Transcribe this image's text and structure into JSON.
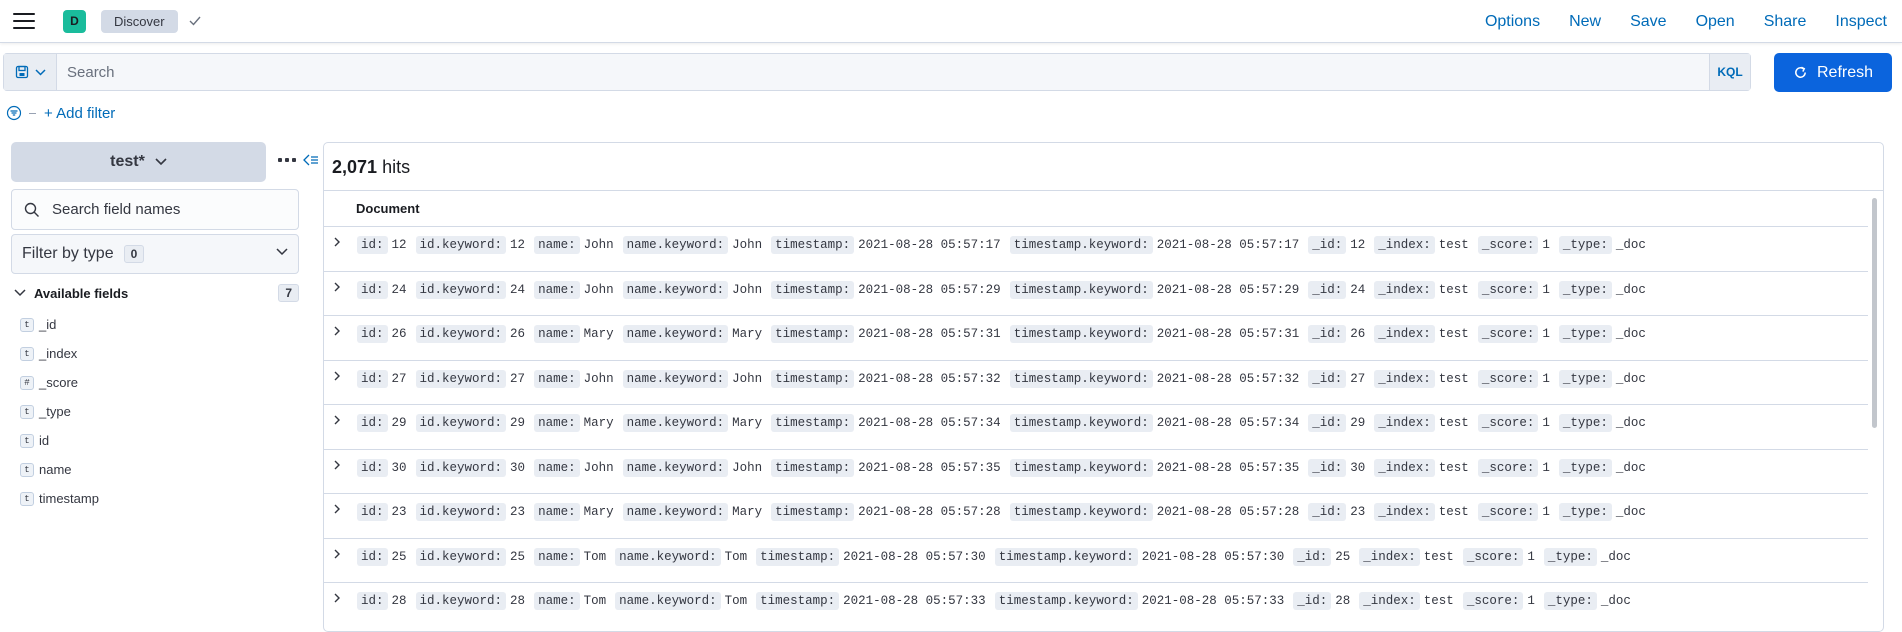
{
  "header": {
    "space_initial": "D",
    "breadcrumb": "Discover",
    "links": [
      "Options",
      "New",
      "Save",
      "Open",
      "Share",
      "Inspect"
    ]
  },
  "query": {
    "placeholder": "Search",
    "language": "KQL",
    "refresh_label": "Refresh"
  },
  "filters": {
    "add_label": "+ Add filter"
  },
  "sidebar": {
    "index_pattern": "test*",
    "search_placeholder": "Search field names",
    "filter_by_type_label": "Filter by type",
    "filter_by_type_count": "0",
    "available_label": "Available fields",
    "available_count": "7",
    "fields": [
      {
        "type": "t",
        "name": "_id"
      },
      {
        "type": "t",
        "name": "_index"
      },
      {
        "type": "#",
        "name": "_score"
      },
      {
        "type": "t",
        "name": "_type"
      },
      {
        "type": "t",
        "name": "id"
      },
      {
        "type": "t",
        "name": "name"
      },
      {
        "type": "t",
        "name": "timestamp"
      }
    ]
  },
  "results": {
    "hits_count": "2,071",
    "hits_label": "hits",
    "column_header": "Document",
    "rows": [
      {
        "id": "12",
        "name": "John",
        "timestamp": "2021-08-28 05:57:17",
        "_index": "test",
        "_score": "1",
        "_type": "_doc"
      },
      {
        "id": "24",
        "name": "John",
        "timestamp": "2021-08-28 05:57:29",
        "_index": "test",
        "_score": "1",
        "_type": "_doc"
      },
      {
        "id": "26",
        "name": "Mary",
        "timestamp": "2021-08-28 05:57:31",
        "_index": "test",
        "_score": "1",
        "_type": "_doc"
      },
      {
        "id": "27",
        "name": "John",
        "timestamp": "2021-08-28 05:57:32",
        "_index": "test",
        "_score": "1",
        "_type": "_doc"
      },
      {
        "id": "29",
        "name": "Mary",
        "timestamp": "2021-08-28 05:57:34",
        "_index": "test",
        "_score": "1",
        "_type": "_doc"
      },
      {
        "id": "30",
        "name": "John",
        "timestamp": "2021-08-28 05:57:35",
        "_index": "test",
        "_score": "1",
        "_type": "_doc"
      },
      {
        "id": "23",
        "name": "Mary",
        "timestamp": "2021-08-28 05:57:28",
        "_index": "test",
        "_score": "1",
        "_type": "_doc"
      },
      {
        "id": "25",
        "name": "Tom",
        "timestamp": "2021-08-28 05:57:30",
        "_index": "test",
        "_score": "1",
        "_type": "_doc"
      },
      {
        "id": "28",
        "name": "Tom",
        "timestamp": "2021-08-28 05:57:33",
        "_index": "test",
        "_score": "1",
        "_type": "_doc"
      }
    ]
  },
  "icons": {
    "menu": "hamburger-icon",
    "check": "check-icon",
    "saved_query": "save-icon",
    "refresh": "refresh-icon",
    "filter": "filter-icon",
    "search": "search-icon",
    "expand": "chevron-right-icon"
  },
  "colors": {
    "accent": "#006bb8",
    "refresh_button": "#0b64dd",
    "space_avatar": "#1abc9c"
  }
}
